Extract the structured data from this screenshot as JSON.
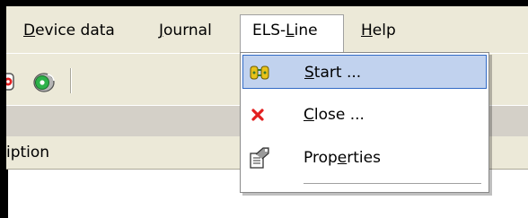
{
  "menubar": {
    "items": [
      {
        "label_pre": "",
        "mnemonic": "D",
        "label_post": "evice data"
      },
      {
        "label_pre": "",
        "mnemonic": "J",
        "label_post": "ournal"
      },
      {
        "label_pre": "ELS-",
        "mnemonic": "L",
        "label_post": "ine"
      },
      {
        "label_pre": "",
        "mnemonic": "H",
        "label_post": "elp"
      }
    ]
  },
  "toolbar": {
    "icons": [
      "partial-red-device-icon",
      "green-disc-icon"
    ]
  },
  "list_header": {
    "column_text": "iption"
  },
  "dropdown": {
    "items": [
      {
        "label_pre": "",
        "mnemonic": "S",
        "label_post": "tart ...",
        "icon": "connect-plug-icon",
        "highlighted": true
      },
      {
        "label_pre": "",
        "mnemonic": "C",
        "label_post": "lose ...",
        "icon": "close-x-icon",
        "highlighted": false
      },
      {
        "label_pre": "Prop",
        "mnemonic": "e",
        "label_post": "rties",
        "icon": "properties-icon",
        "highlighted": false
      }
    ]
  },
  "colors": {
    "highlight_bg": "#c1d2ee",
    "highlight_border": "#316ac5",
    "close_red": "#e21f1f"
  }
}
